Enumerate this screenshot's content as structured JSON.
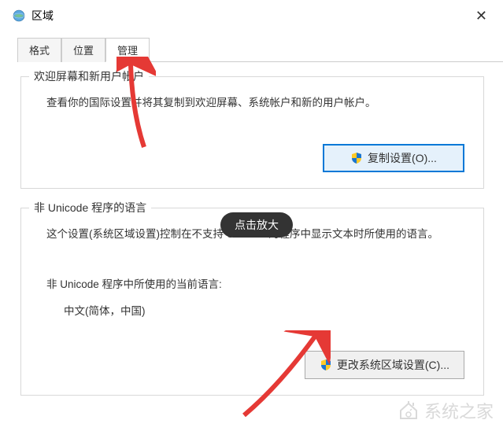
{
  "window": {
    "title": "区域"
  },
  "tabs": {
    "items": [
      {
        "label": "格式"
      },
      {
        "label": "位置"
      },
      {
        "label": "管理"
      }
    ],
    "active_index": 2
  },
  "group1": {
    "legend": "欢迎屏幕和新用户帐户",
    "desc": "查看你的国际设置并将其复制到欢迎屏幕、系统帐户和新的用户帐户。",
    "button": "复制设置(O)..."
  },
  "group2": {
    "legend": "非 Unicode 程序的语言",
    "desc": "这个设置(系统区域设置)控制在不支持 Unicode 的程序中显示文本时所使用的语言。",
    "current_label": "非 Unicode 程序中所使用的当前语言:",
    "current_value": "中文(简体，中国)",
    "button": "更改系统区域设置(C)..."
  },
  "tooltip": {
    "text": "点击放大"
  },
  "watermark": {
    "text": "系统之家"
  }
}
